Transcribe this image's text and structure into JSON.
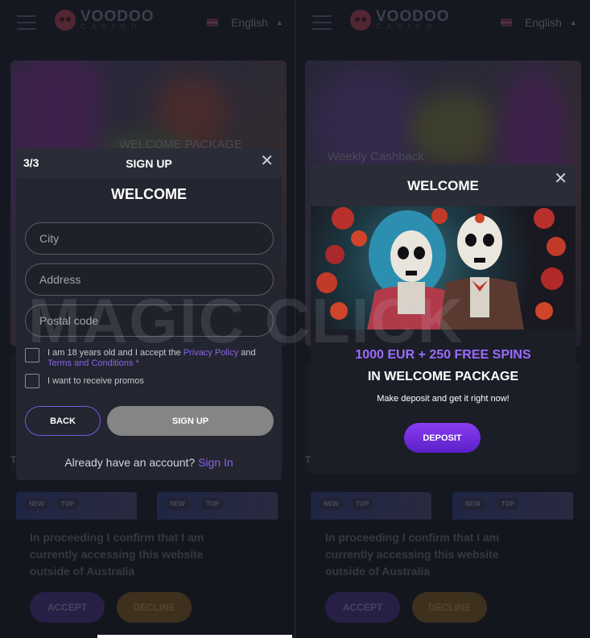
{
  "header": {
    "logo_main": "VOODOO",
    "logo_sub": "CASINO",
    "language": "English"
  },
  "left": {
    "banner_label": "WELCOME PACKAGE",
    "side_letter": "T",
    "mini_tags": [
      "NEW",
      "TOP",
      "NEW",
      "TOP"
    ],
    "signup": {
      "step": "3/3",
      "title": "SIGN UP",
      "welcome": "WELCOME",
      "city_placeholder": "City",
      "address_placeholder": "Address",
      "postal_placeholder": "Postal code",
      "age_text_before": "I am 18 years old and I accept the ",
      "privacy_link": "Privacy Policy",
      "age_text_mid": " and",
      "terms_link": "Terms and Conditions",
      "required_mark": " *",
      "promos_text": "I want to receive promos",
      "back_label": "BACK",
      "signup_label": "SIGN UP",
      "already_text": "Already have an account? ",
      "signin_link": "Sign In"
    }
  },
  "right": {
    "banner_label": "Weekly Cashback",
    "side_letter": "T",
    "mini_tags": [
      "NEW",
      "TOP",
      "NEW",
      "TOP"
    ],
    "welcome": {
      "title": "WELCOME",
      "offer_line1": "1000 EUR + 250 FREE SPINS",
      "offer_line2": "IN WELCOME PACKAGE",
      "offer_line3": "Make deposit and get it right now!",
      "deposit_label": "DEPOSIT"
    }
  },
  "consent": {
    "text": "In proceeding I confirm that I am currently accessing this website outside of Australia",
    "accept_label": "ACCEPT",
    "decline_label": "DECLINE"
  },
  "watermark": "MAGIC CLICK",
  "colors": {
    "accent_purple": "#8a63e6",
    "offer_purple": "#9b6bff",
    "background": "#1d1f2a"
  },
  "icons": {
    "menu": "hamburger-menu-icon",
    "close": "close-icon",
    "flag": "uk-flag-icon",
    "caret": "chevron-up-icon"
  }
}
